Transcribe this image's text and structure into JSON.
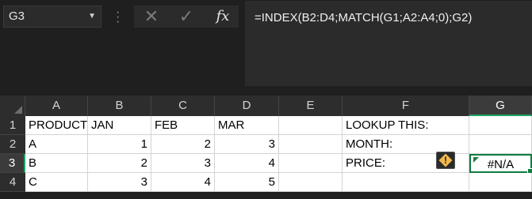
{
  "formula_bar": {
    "name_box": "G3",
    "fx_label": "fx",
    "formula": "=INDEX(B2:D4;MATCH(G1;A2:A4;0);G2)"
  },
  "columns": [
    "A",
    "B",
    "C",
    "D",
    "E",
    "F",
    "G"
  ],
  "rows": [
    "1",
    "2",
    "3",
    "4"
  ],
  "cells": {
    "A1": "PRODUCT",
    "B1": "JAN",
    "C1": "FEB",
    "D1": "MAR",
    "F1": "LOOKUP THIS:",
    "A2": "A",
    "B2": "1",
    "C2": "2",
    "D2": "3",
    "F2": "MONTH:",
    "A3": "B",
    "B3": "2",
    "C3": "3",
    "D3": "4",
    "F3": "PRICE:",
    "G3": "#N/A",
    "A4": "C",
    "B4": "3",
    "C4": "4",
    "D4": "5"
  },
  "icons": {
    "cancel": "cancel-x-icon",
    "enter": "enter-check-icon",
    "warning": "error-warning-icon"
  },
  "colors": {
    "selection": "#107c41",
    "warning": "#f2b84b"
  }
}
